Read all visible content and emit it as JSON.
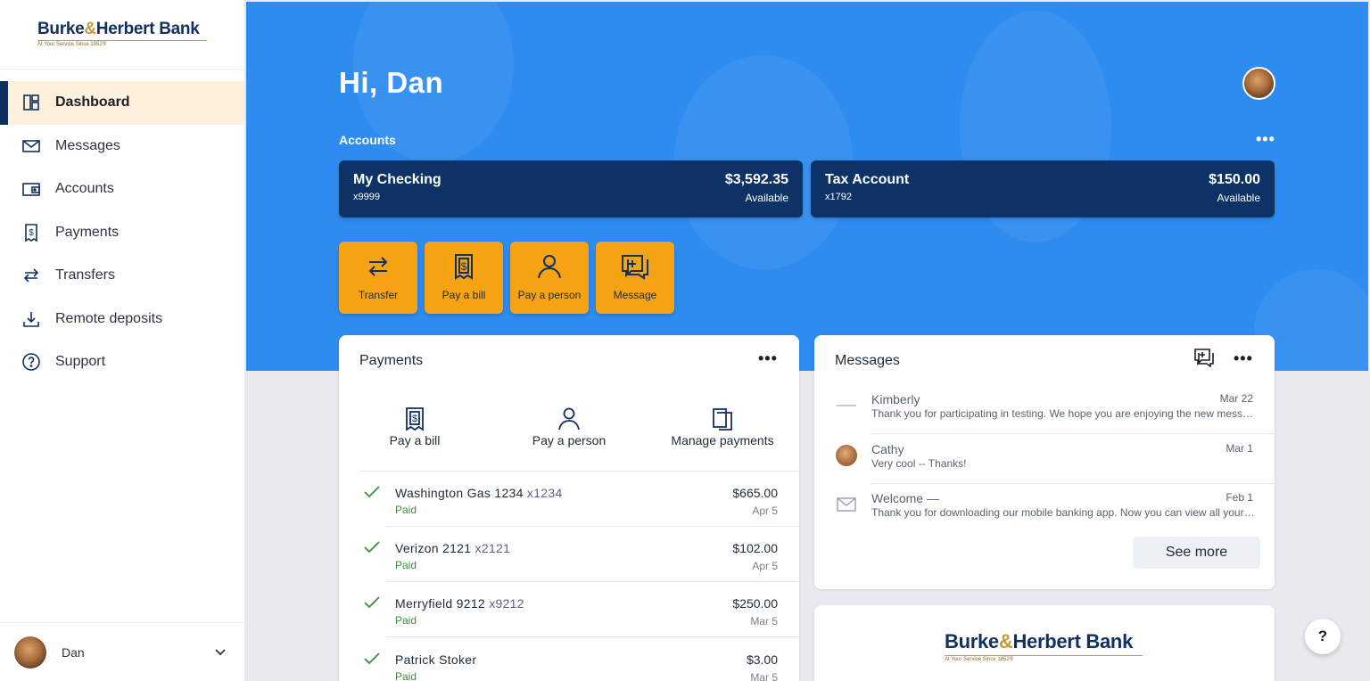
{
  "brand": {
    "name_part1": "Burke",
    "amp": "&",
    "name_part2": "Herbert Bank",
    "tagline": "At Your Service Since 1852®"
  },
  "sidebar": {
    "items": [
      {
        "label": "Dashboard",
        "icon": "dashboard-icon"
      },
      {
        "label": "Messages",
        "icon": "envelope-icon"
      },
      {
        "label": "Accounts",
        "icon": "wallet-icon"
      },
      {
        "label": "Payments",
        "icon": "bill-icon"
      },
      {
        "label": "Transfers",
        "icon": "transfer-arrows-icon"
      },
      {
        "label": "Remote deposits",
        "icon": "download-icon"
      },
      {
        "label": "Support",
        "icon": "help-circle-icon"
      }
    ],
    "user": {
      "name": "Dan"
    }
  },
  "hero": {
    "greeting": "Hi, Dan",
    "accounts_label": "Accounts",
    "more": "•••",
    "accounts": [
      {
        "name": "My Checking",
        "number": "x9999",
        "balance": "$3,592.35",
        "balance_label": "Available"
      },
      {
        "name": "Tax Account",
        "number": "x1792",
        "balance": "$150.00",
        "balance_label": "Available"
      }
    ],
    "quick_actions": [
      {
        "label": "Transfer",
        "icon": "transfer-icon"
      },
      {
        "label": "Pay a bill",
        "icon": "bill-icon"
      },
      {
        "label": "Pay a person",
        "icon": "person-icon"
      },
      {
        "label": "Message",
        "icon": "compose-message-icon"
      }
    ]
  },
  "payments": {
    "title": "Payments",
    "more": "•••",
    "actions": [
      {
        "label": "Pay a bill",
        "icon": "bill-icon"
      },
      {
        "label": "Pay a person",
        "icon": "person-icon"
      },
      {
        "label": "Manage payments",
        "icon": "documents-icon"
      }
    ],
    "rows": [
      {
        "name": "Washington Gas 1234",
        "account": "x1234",
        "status": "Paid",
        "amount": "$665.00",
        "date": "Apr 5"
      },
      {
        "name": "Verizon 2121",
        "account": "x2121",
        "status": "Paid",
        "amount": "$102.00",
        "date": "Apr 5"
      },
      {
        "name": "Merryfield 9212",
        "account": "x9212",
        "status": "Paid",
        "amount": "$250.00",
        "date": "Mar 5"
      },
      {
        "name": "Patrick Stoker",
        "account": "",
        "status": "Paid",
        "amount": "$3.00",
        "date": "Mar 5"
      }
    ]
  },
  "messages": {
    "title": "Messages",
    "more": "•••",
    "rows": [
      {
        "sender": "Kimberly",
        "date": "Mar 22",
        "preview": "Thank you for participating in testing. We hope you are enjoying the new messaging experience."
      },
      {
        "sender": "Cathy",
        "date": "Mar 1",
        "preview": "Very cool -- Thanks!"
      },
      {
        "sender": "Welcome —",
        "date": "Feb 1",
        "preview": "Thank you for downloading our mobile banking app. Now you can view all your accounts."
      }
    ],
    "see_more": "See more"
  },
  "help": {
    "label": "?"
  }
}
